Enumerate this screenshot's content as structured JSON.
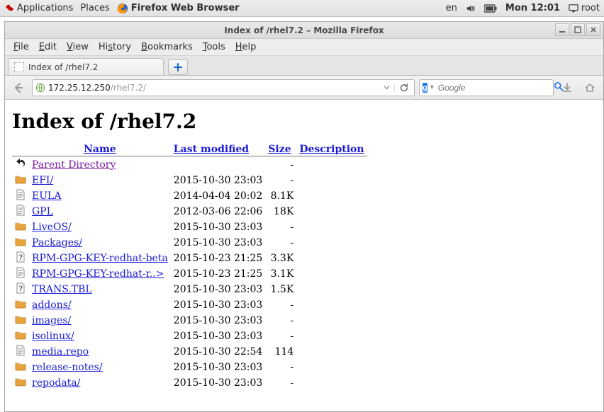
{
  "panel": {
    "applications": "Applications",
    "places": "Places",
    "activeApp": "Firefox Web Browser",
    "lang": "en",
    "clock": "Mon 12:01",
    "user": "root"
  },
  "window": {
    "title": "Index of /rhel7.2 – Mozilla Firefox"
  },
  "menubar": {
    "file": "File",
    "edit": "Edit",
    "view": "View",
    "history": "History",
    "bookmarks": "Bookmarks",
    "tools": "Tools",
    "help": "Help"
  },
  "tabs": {
    "active": "Index of /rhel7.2"
  },
  "url": {
    "host": "172.25.12.250",
    "path": "/rhel7.2/"
  },
  "search": {
    "engineInitial": "g",
    "placeholder": "Google"
  },
  "page": {
    "heading": "Index of /rhel7.2",
    "columns": {
      "name": "Name",
      "lastModified": "Last modified",
      "size": "Size",
      "description": "Description"
    },
    "parentLabel": "Parent Directory",
    "rows": [
      {
        "icon": "folder",
        "name": "EFI/",
        "date": "2015-10-30 23:03",
        "size": "-"
      },
      {
        "icon": "file",
        "name": "EULA",
        "date": "2014-04-04 20:02",
        "size": "8.1K"
      },
      {
        "icon": "file",
        "name": "GPL",
        "date": "2012-03-06 22:06",
        "size": "18K"
      },
      {
        "icon": "folder",
        "name": "LiveOS/",
        "date": "2015-10-30 23:03",
        "size": "-"
      },
      {
        "icon": "folder",
        "name": "Packages/",
        "date": "2015-10-30 23:03",
        "size": "-"
      },
      {
        "icon": "unknown",
        "name": "RPM-GPG-KEY-redhat-beta",
        "date": "2015-10-23 21:25",
        "size": "3.3K"
      },
      {
        "icon": "file",
        "name": "RPM-GPG-KEY-redhat-r..>",
        "date": "2015-10-23 21:25",
        "size": "3.1K"
      },
      {
        "icon": "unknown",
        "name": "TRANS.TBL",
        "date": "2015-10-30 23:03",
        "size": "1.5K"
      },
      {
        "icon": "folder",
        "name": "addons/",
        "date": "2015-10-30 23:03",
        "size": "-"
      },
      {
        "icon": "folder",
        "name": "images/",
        "date": "2015-10-30 23:03",
        "size": "-"
      },
      {
        "icon": "folder",
        "name": "isolinux/",
        "date": "2015-10-30 23:03",
        "size": "-"
      },
      {
        "icon": "file",
        "name": "media.repo",
        "date": "2015-10-30 22:54",
        "size": "114"
      },
      {
        "icon": "folder",
        "name": "release-notes/",
        "date": "2015-10-30 23:03",
        "size": "-"
      },
      {
        "icon": "folder",
        "name": "repodata/",
        "date": "2015-10-30 23:03",
        "size": "-"
      }
    ]
  }
}
